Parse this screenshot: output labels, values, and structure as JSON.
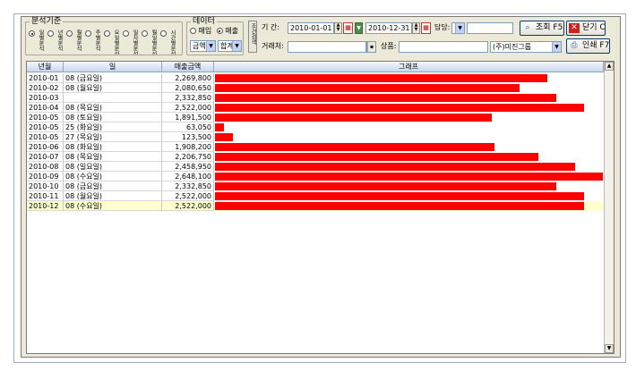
{
  "criteria_group": {
    "title": "분석기준",
    "options": [
      {
        "label": "일별분석",
        "selected": true
      },
      {
        "label": "년별분석",
        "selected": false
      },
      {
        "label": "월별분석",
        "selected": false
      },
      {
        "label": "주별분석",
        "selected": false
      },
      {
        "label": "요일별분석",
        "selected": false
      },
      {
        "label": "일자별분석",
        "selected": false
      },
      {
        "label": "월일별분석",
        "selected": false
      },
      {
        "label": "시간별분석",
        "selected": false
      }
    ]
  },
  "data_group": {
    "title": "데이터",
    "radio_purchase": "매입",
    "radio_sales": "매출",
    "amount_select": "금액",
    "total_select": "합계"
  },
  "side_tab_label": "조건검색",
  "filters": {
    "period_label": "기   간:",
    "date_from": "2010-01-01",
    "date_to": "2010-12-31",
    "manager_label": "담당:",
    "manager_value": "",
    "client_label": "거래처:",
    "client_value": "",
    "product_label": "상품:",
    "product_value": "",
    "company_select": "(주)미진그룹"
  },
  "buttons": {
    "search": "조회 F5",
    "close": "닫기 C",
    "print": "인쇄 F7"
  },
  "grid": {
    "headers": {
      "ym": "년월",
      "day": "일",
      "amount": "매출금액",
      "graph": "그래프"
    },
    "max_value": 2648100,
    "rows": [
      {
        "ym": "2010-01",
        "day": "08 (금요일)",
        "amount": "2,269,800",
        "value": 2269800
      },
      {
        "ym": "2010-02",
        "day": "08 (월요일)",
        "amount": "2,080,650",
        "value": 2080650
      },
      {
        "ym": "2010-03",
        "day": "",
        "amount": "2,332,850",
        "value": 2332850
      },
      {
        "ym": "2010-04",
        "day": "08 (목요일)",
        "amount": "2,522,000",
        "value": 2522000
      },
      {
        "ym": "2010-05",
        "day": "08 (토요일)",
        "amount": "1,891,500",
        "value": 1891500
      },
      {
        "ym": "2010-05",
        "day": "25 (화요일)",
        "amount": "63,050",
        "value": 63050
      },
      {
        "ym": "2010-05",
        "day": "27 (목요일)",
        "amount": "123,500",
        "value": 123500
      },
      {
        "ym": "2010-06",
        "day": "08 (화요일)",
        "amount": "1,908,200",
        "value": 1908200
      },
      {
        "ym": "2010-07",
        "day": "08 (목요일)",
        "amount": "2,206,750",
        "value": 2206750
      },
      {
        "ym": "2010-08",
        "day": "08 (일요일)",
        "amount": "2,458,950",
        "value": 2458950
      },
      {
        "ym": "2010-09",
        "day": "08 (수요일)",
        "amount": "2,648,100",
        "value": 2648100
      },
      {
        "ym": "2010-10",
        "day": "08 (금요일)",
        "amount": "2,332,850",
        "value": 2332850
      },
      {
        "ym": "2010-11",
        "day": "08 (월요일)",
        "amount": "2,522,000",
        "value": 2522000
      },
      {
        "ym": "2010-12",
        "day": "08 (수요일)",
        "amount": "2,522,000",
        "value": 2522000
      }
    ]
  },
  "colors": {
    "bar": "#ff0000",
    "selected_row": "#ffffd0",
    "header": "#c7d6ef"
  }
}
